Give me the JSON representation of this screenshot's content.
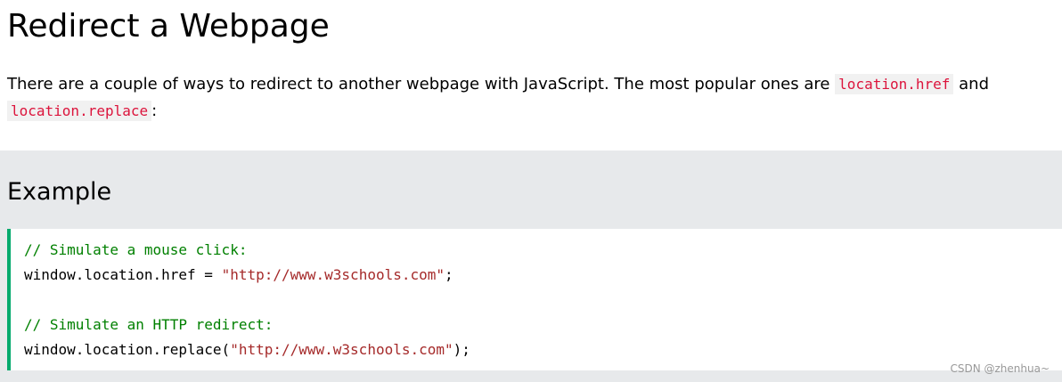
{
  "title": "Redirect a Webpage",
  "intro": {
    "text_before": "There are a couple of ways to redirect to another webpage with JavaScript. The most popular ones are ",
    "code_1": "location.href",
    "text_middle": " and ",
    "code_2": "location.replace",
    "text_after": ":"
  },
  "example": {
    "heading": "Example",
    "lines": {
      "comment_1": "// Simulate a mouse click:",
      "code_1_prefix": "window.location.href = ",
      "code_1_string": "\"http://www.w3schools.com\"",
      "code_1_suffix": ";",
      "comment_2": "// Simulate an HTTP redirect:",
      "code_2_prefix": "window.location.replace(",
      "code_2_string": "\"http://www.w3schools.com\"",
      "code_2_suffix": ");"
    }
  },
  "watermark": "CSDN @zhenhua~",
  "colors": {
    "inline_code": "#dc143c",
    "comment": "#008000",
    "string": "#a52a2a",
    "accent_border": "#04aa6d",
    "panel_background": "#e7e9eb"
  }
}
